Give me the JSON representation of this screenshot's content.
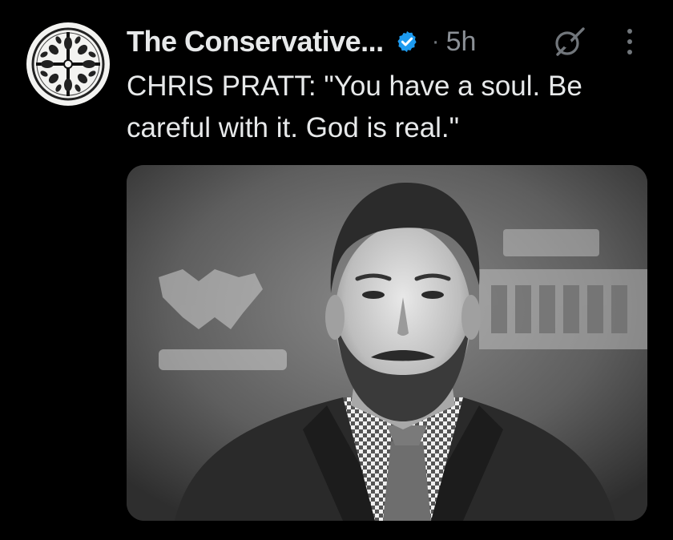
{
  "post": {
    "author": {
      "display_name": "The Conservative...",
      "verified": true,
      "avatar_icon": "cross-emblem-icon"
    },
    "separator": "·",
    "timestamp": "5h",
    "text": "CHRIS PRATT: \"You have a soul. Be careful with it. God is real.\"",
    "actions": {
      "grok_icon": "grok-icon",
      "more_icon": "more-vertical-icon"
    },
    "media": {
      "type": "photo",
      "style": "black-and-white"
    }
  },
  "colors": {
    "background": "#000000",
    "text_primary": "#e7e9ea",
    "text_secondary": "#71767b",
    "verified_badge": "#1d9bf0"
  }
}
